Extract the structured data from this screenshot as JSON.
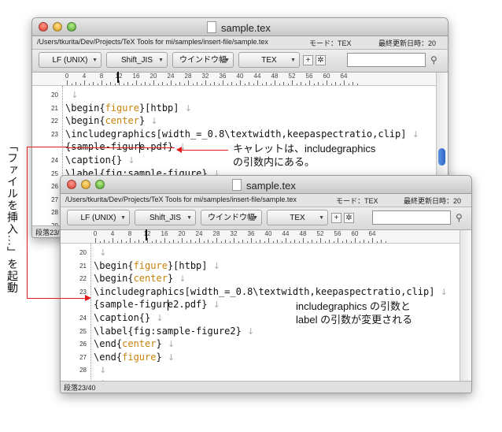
{
  "window1": {
    "title": "sample.tex",
    "path": "/Users/tkurita/Dev/Projects/TeX Tools for mi/samples/insert-file/sample.tex",
    "mode": "モード：TEX",
    "updated": "最終更新日時：20",
    "toolbar": {
      "line_ending": "LF (UNIX)",
      "encoding": "Shift_JIS",
      "window_width": "ウインドウ幅",
      "mode": "TEX",
      "plus_label": "+",
      "gear_icon": "gear-icon",
      "search_icon": "search-icon"
    },
    "ruler": [
      "0",
      "4",
      "8",
      "12",
      "16",
      "20",
      "24",
      "28",
      "32",
      "36",
      "40",
      "44",
      "48",
      "52",
      "56",
      "60",
      "64"
    ],
    "lines": [
      {
        "num": "20",
        "text": ""
      },
      {
        "num": "21",
        "text": "\\begin{figure}[htbp]"
      },
      {
        "num": "22",
        "text": "\\begin{center}"
      },
      {
        "num": "23",
        "text": "\\includegraphics[width_=_0.8\\textwidth,keepaspectratio,clip]"
      },
      {
        "num": "",
        "text": "{sample-figure.pdf}"
      },
      {
        "num": "24",
        "text": "\\caption{}"
      },
      {
        "num": "25",
        "text": "\\label{fig:sample-figure}"
      },
      {
        "num": "26",
        "text": ""
      },
      {
        "num": "27",
        "text": ""
      },
      {
        "num": "28",
        "text": ""
      },
      {
        "num": "29",
        "text": ""
      }
    ],
    "status": "段落23/"
  },
  "window2": {
    "title": "sample.tex",
    "path": "/Users/tkurita/Dev/Projects/TeX Tools for mi/samples/insert-file/sample.tex",
    "mode": "モード：TEX",
    "updated": "最終更新日時：20",
    "toolbar": {
      "line_ending": "LF (UNIX)",
      "encoding": "Shift_JIS",
      "window_width": "ウインドウ幅",
      "mode": "TEX",
      "plus_label": "+",
      "gear_icon": "gear-icon",
      "search_icon": "search-icon"
    },
    "ruler": [
      "0",
      "4",
      "8",
      "12",
      "16",
      "20",
      "24",
      "28",
      "32",
      "36",
      "40",
      "44",
      "48",
      "52",
      "56",
      "60",
      "64"
    ],
    "lines": [
      {
        "num": "20",
        "text": ""
      },
      {
        "num": "21",
        "text": "\\begin{figure}[htbp]"
      },
      {
        "num": "22",
        "text": "\\begin{center}"
      },
      {
        "num": "23",
        "text": "\\includegraphics[width_=_0.8\\textwidth,keepaspectratio,clip]"
      },
      {
        "num": "",
        "text": "{sample-figure2.pdf}"
      },
      {
        "num": "24",
        "text": "\\caption{}"
      },
      {
        "num": "25",
        "text": "\\label{fig:sample-figure2}"
      },
      {
        "num": "26",
        "text": "\\end{center}"
      },
      {
        "num": "27",
        "text": "\\end{figure}"
      },
      {
        "num": "28",
        "text": ""
      },
      {
        "num": "29",
        "text": ""
      }
    ],
    "status": "段落23/40"
  },
  "annotations": {
    "caret_note_line1": "キャレットは、includegraphics",
    "caret_note_line2": "の引数内にある。",
    "change_note_line1": "includegraphics の引数と",
    "change_note_line2": "label の引数が変更される",
    "vertical_note": "「ファイルを挿入...」を起動"
  },
  "colors": {
    "arrow": "#e8191d",
    "argument": "#c8820a"
  }
}
